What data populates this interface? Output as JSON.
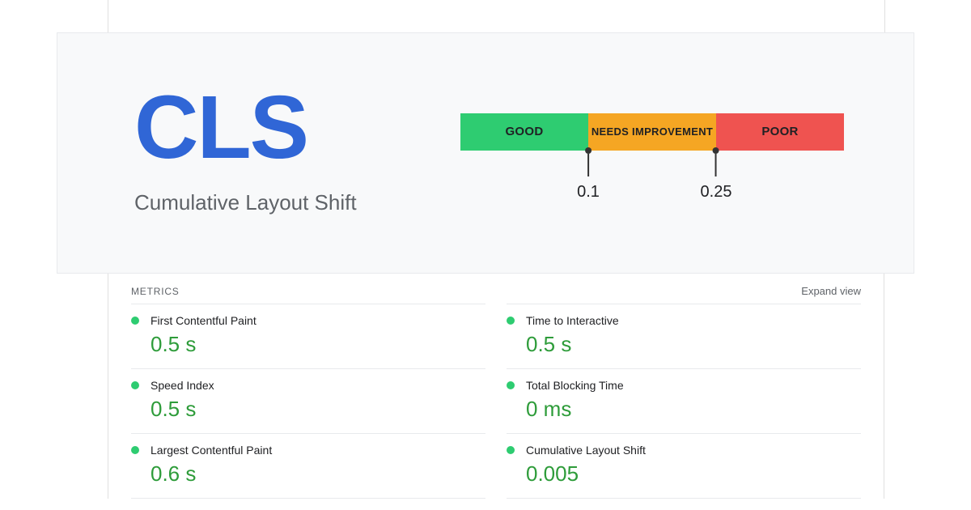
{
  "hero": {
    "title": "CLS",
    "subtitle": "Cumulative Layout Shift",
    "thresholds": {
      "good_label": "GOOD",
      "needs_label": "NEEDS IMPROVEMENT",
      "poor_label": "POOR",
      "t1": "0.1",
      "t2": "0.25"
    }
  },
  "metrics": {
    "section_title": "METRICS",
    "expand_label": "Expand view",
    "left": [
      {
        "name": "First Contentful Paint",
        "value": "0.5 s",
        "status": "good"
      },
      {
        "name": "Speed Index",
        "value": "0.5 s",
        "status": "good"
      },
      {
        "name": "Largest Contentful Paint",
        "value": "0.6 s",
        "status": "good"
      }
    ],
    "right": [
      {
        "name": "Time to Interactive",
        "value": "0.5 s",
        "status": "good"
      },
      {
        "name": "Total Blocking Time",
        "value": "0 ms",
        "status": "good"
      },
      {
        "name": "Cumulative Layout Shift",
        "value": "0.005",
        "status": "good"
      }
    ]
  },
  "colors": {
    "good": "#2ecc71",
    "needs": "#f5a623",
    "poor": "#ef5350",
    "value_green": "#2e9c3a",
    "brand_blue": "#3066d6"
  }
}
